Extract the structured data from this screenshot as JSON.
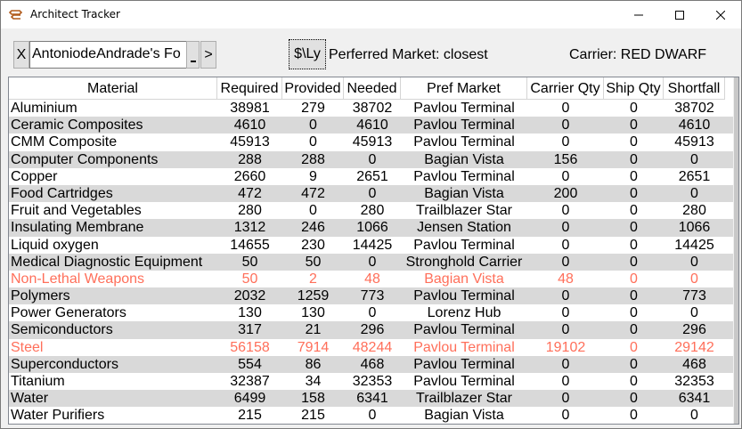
{
  "window": {
    "title": "Architect Tracker",
    "icon": "architect-app-icon"
  },
  "toolbar": {
    "close_label": "X",
    "commander_value": "AntoniodeAndrade's Fo",
    "next_label": ">",
    "currency_label": "$\\Ly",
    "preferred_market_text": "Perferred Market: closest",
    "carrier_text": "Carrier: RED DWARF"
  },
  "colors": {
    "warning_text": "#ff6f5a",
    "alt_row": "#d9d9d9"
  },
  "table": {
    "headers": [
      "Material",
      "Required",
      "Provided",
      "Needed",
      "Pref Market",
      "Carrier Qty",
      "Ship Qty",
      "Shortfall"
    ],
    "rows": [
      {
        "material": "Aluminium",
        "required": "38981",
        "provided": "279",
        "needed": "38702",
        "market": "Pavlou Terminal",
        "carrier": "0",
        "ship": "0",
        "shortfall": "38702",
        "warn": false
      },
      {
        "material": "Ceramic Composites",
        "required": "4610",
        "provided": "0",
        "needed": "4610",
        "market": "Pavlou Terminal",
        "carrier": "0",
        "ship": "0",
        "shortfall": "4610",
        "warn": false
      },
      {
        "material": "CMM Composite",
        "required": "45913",
        "provided": "0",
        "needed": "45913",
        "market": "Pavlou Terminal",
        "carrier": "0",
        "ship": "0",
        "shortfall": "45913",
        "warn": false
      },
      {
        "material": "Computer Components",
        "required": "288",
        "provided": "288",
        "needed": "0",
        "market": "Bagian Vista",
        "carrier": "156",
        "ship": "0",
        "shortfall": "0",
        "warn": false
      },
      {
        "material": "Copper",
        "required": "2660",
        "provided": "9",
        "needed": "2651",
        "market": "Pavlou Terminal",
        "carrier": "0",
        "ship": "0",
        "shortfall": "2651",
        "warn": false
      },
      {
        "material": "Food Cartridges",
        "required": "472",
        "provided": "472",
        "needed": "0",
        "market": "Bagian Vista",
        "carrier": "200",
        "ship": "0",
        "shortfall": "0",
        "warn": false
      },
      {
        "material": "Fruit and Vegetables",
        "required": "280",
        "provided": "0",
        "needed": "280",
        "market": "Trailblazer Star",
        "carrier": "0",
        "ship": "0",
        "shortfall": "280",
        "warn": false
      },
      {
        "material": "Insulating Membrane",
        "required": "1312",
        "provided": "246",
        "needed": "1066",
        "market": "Jensen Station",
        "carrier": "0",
        "ship": "0",
        "shortfall": "1066",
        "warn": false
      },
      {
        "material": "Liquid oxygen",
        "required": "14655",
        "provided": "230",
        "needed": "14425",
        "market": "Pavlou Terminal",
        "carrier": "0",
        "ship": "0",
        "shortfall": "14425",
        "warn": false
      },
      {
        "material": "Medical Diagnostic Equipment",
        "required": "50",
        "provided": "50",
        "needed": "0",
        "market": "Stronghold Carrier",
        "carrier": "0",
        "ship": "0",
        "shortfall": "0",
        "warn": false
      },
      {
        "material": "Non-Lethal Weapons",
        "required": "50",
        "provided": "2",
        "needed": "48",
        "market": "Bagian Vista",
        "carrier": "48",
        "ship": "0",
        "shortfall": "0",
        "warn": true
      },
      {
        "material": "Polymers",
        "required": "2032",
        "provided": "1259",
        "needed": "773",
        "market": "Pavlou Terminal",
        "carrier": "0",
        "ship": "0",
        "shortfall": "773",
        "warn": false
      },
      {
        "material": "Power Generators",
        "required": "130",
        "provided": "130",
        "needed": "0",
        "market": "Lorenz Hub",
        "carrier": "0",
        "ship": "0",
        "shortfall": "0",
        "warn": false
      },
      {
        "material": "Semiconductors",
        "required": "317",
        "provided": "21",
        "needed": "296",
        "market": "Pavlou Terminal",
        "carrier": "0",
        "ship": "0",
        "shortfall": "296",
        "warn": false
      },
      {
        "material": "Steel",
        "required": "56158",
        "provided": "7914",
        "needed": "48244",
        "market": "Pavlou Terminal",
        "carrier": "19102",
        "ship": "0",
        "shortfall": "29142",
        "warn": true
      },
      {
        "material": "Superconductors",
        "required": "554",
        "provided": "86",
        "needed": "468",
        "market": "Pavlou Terminal",
        "carrier": "0",
        "ship": "0",
        "shortfall": "468",
        "warn": false
      },
      {
        "material": "Titanium",
        "required": "32387",
        "provided": "34",
        "needed": "32353",
        "market": "Pavlou Terminal",
        "carrier": "0",
        "ship": "0",
        "shortfall": "32353",
        "warn": false
      },
      {
        "material": "Water",
        "required": "6499",
        "provided": "158",
        "needed": "6341",
        "market": "Trailblazer Star",
        "carrier": "0",
        "ship": "0",
        "shortfall": "6341",
        "warn": false
      },
      {
        "material": "Water Purifiers",
        "required": "215",
        "provided": "215",
        "needed": "0",
        "market": "Bagian Vista",
        "carrier": "0",
        "ship": "0",
        "shortfall": "0",
        "warn": false
      }
    ]
  }
}
